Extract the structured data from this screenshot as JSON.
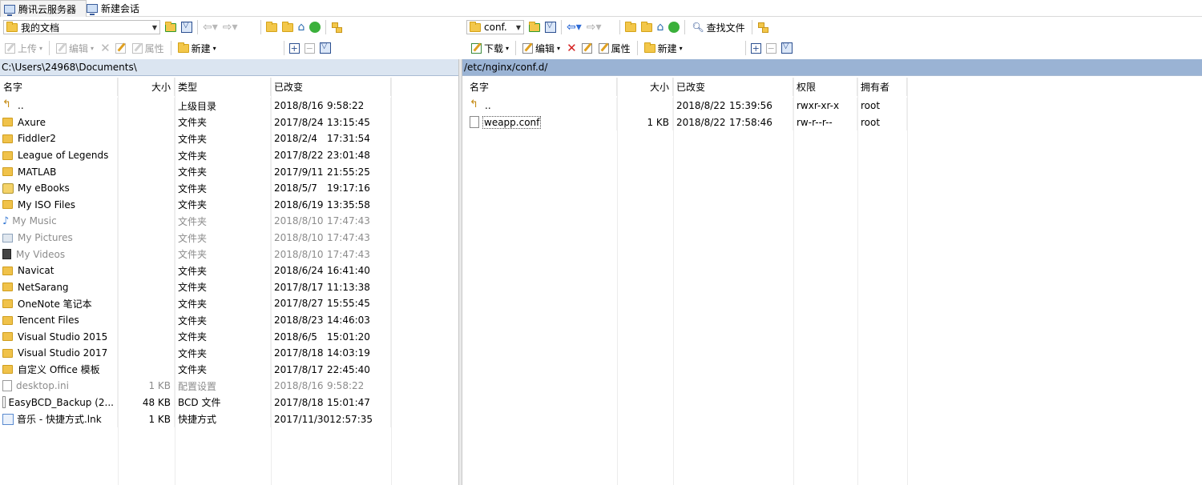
{
  "tabs": [
    {
      "label": "腾讯云服务器",
      "active": true
    },
    {
      "label": "新建会话",
      "active": false
    }
  ],
  "left": {
    "location_combo": "我的文档",
    "toolbar": {
      "upload": "上传",
      "edit": "编辑",
      "properties": "属性",
      "new": "新建"
    },
    "path": "C:\\Users\\24968\\Documents\\",
    "columns": [
      "名字",
      "大小",
      "类型",
      "已改变"
    ],
    "rows": [
      {
        "name": "..",
        "size": "",
        "type": "上级目录",
        "date": "2018/8/16",
        "time": "9:58:22",
        "icon": "parent-dir-icon",
        "muted": false
      },
      {
        "name": "Axure",
        "size": "",
        "type": "文件夹",
        "date": "2017/8/24",
        "time": "13:15:45",
        "icon": "folder-icon",
        "muted": false
      },
      {
        "name": "Fiddler2",
        "size": "",
        "type": "文件夹",
        "date": "2018/2/4",
        "time": "17:31:54",
        "icon": "folder-icon",
        "muted": false
      },
      {
        "name": "League of Legends",
        "size": "",
        "type": "文件夹",
        "date": "2017/8/22",
        "time": "23:01:48",
        "icon": "folder-icon",
        "muted": false
      },
      {
        "name": "MATLAB",
        "size": "",
        "type": "文件夹",
        "date": "2017/9/11",
        "time": "21:55:25",
        "icon": "folder-icon",
        "muted": false
      },
      {
        "name": "My eBooks",
        "size": "",
        "type": "文件夹",
        "date": "2018/5/7",
        "time": "19:17:16",
        "icon": "ebook-folder-icon",
        "muted": false
      },
      {
        "name": "My ISO Files",
        "size": "",
        "type": "文件夹",
        "date": "2018/6/19",
        "time": "13:35:58",
        "icon": "folder-icon",
        "muted": false
      },
      {
        "name": "My Music",
        "size": "",
        "type": "文件夹",
        "date": "2018/8/10",
        "time": "17:47:43",
        "icon": "music-folder-icon",
        "muted": true
      },
      {
        "name": "My Pictures",
        "size": "",
        "type": "文件夹",
        "date": "2018/8/10",
        "time": "17:47:43",
        "icon": "pictures-folder-icon",
        "muted": true
      },
      {
        "name": "My Videos",
        "size": "",
        "type": "文件夹",
        "date": "2018/8/10",
        "time": "17:47:43",
        "icon": "videos-folder-icon",
        "muted": true
      },
      {
        "name": "Navicat",
        "size": "",
        "type": "文件夹",
        "date": "2018/6/24",
        "time": "16:41:40",
        "icon": "folder-icon",
        "muted": false
      },
      {
        "name": "NetSarang",
        "size": "",
        "type": "文件夹",
        "date": "2017/8/17",
        "time": "11:13:38",
        "icon": "folder-icon",
        "muted": false
      },
      {
        "name": "OneNote 笔记本",
        "size": "",
        "type": "文件夹",
        "date": "2017/8/27",
        "time": "15:55:45",
        "icon": "folder-icon",
        "muted": false
      },
      {
        "name": "Tencent Files",
        "size": "",
        "type": "文件夹",
        "date": "2018/8/23",
        "time": "14:46:03",
        "icon": "folder-icon",
        "muted": false
      },
      {
        "name": "Visual Studio 2015",
        "size": "",
        "type": "文件夹",
        "date": "2018/6/5",
        "time": "15:01:20",
        "icon": "folder-icon",
        "muted": false
      },
      {
        "name": "Visual Studio 2017",
        "size": "",
        "type": "文件夹",
        "date": "2017/8/18",
        "time": "14:03:19",
        "icon": "folder-icon",
        "muted": false
      },
      {
        "name": "自定义 Office 模板",
        "size": "",
        "type": "文件夹",
        "date": "2017/8/17",
        "time": "22:45:40",
        "icon": "folder-icon",
        "muted": false
      },
      {
        "name": "desktop.ini",
        "size": "1 KB",
        "type": "配置设置",
        "date": "2018/8/16",
        "time": "9:58:22",
        "icon": "settings-file-icon",
        "muted": true
      },
      {
        "name": "EasyBCD_Backup (2...",
        "size": "48 KB",
        "type": "BCD 文件",
        "date": "2017/8/18",
        "time": "15:01:47",
        "icon": "file-icon",
        "muted": false
      },
      {
        "name": "音乐 - 快捷方式.lnk",
        "size": "1 KB",
        "type": "快捷方式",
        "date": "2017/11/30",
        "time": "12:57:35",
        "icon": "shortcut-icon",
        "muted": false
      }
    ]
  },
  "right": {
    "location_combo": "conf.",
    "toolbar": {
      "download": "下载",
      "edit": "编辑",
      "properties": "属性",
      "new": "新建",
      "find_files": "查找文件"
    },
    "path": "/etc/nginx/conf.d/",
    "columns": [
      "名字",
      "大小",
      "已改变",
      "权限",
      "拥有者"
    ],
    "rows": [
      {
        "name": "..",
        "size": "",
        "date": "2018/8/22",
        "time": "15:39:56",
        "perm": "rwxr-xr-x",
        "owner": "root",
        "icon": "parent-dir-icon"
      },
      {
        "name": "weapp.conf",
        "size": "1 KB",
        "date": "2018/8/22",
        "time": "17:58:46",
        "perm": "rw-r--r--",
        "owner": "root",
        "icon": "file-icon"
      }
    ]
  }
}
